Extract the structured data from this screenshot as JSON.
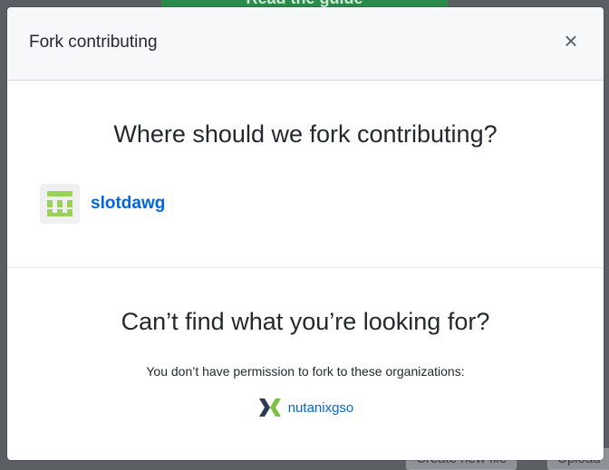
{
  "background": {
    "banner_label": "Read the guide",
    "buttons": [
      "Create new file",
      "Upload"
    ]
  },
  "modal": {
    "title": "Fork contributing",
    "close_icon": "close-icon",
    "heading": "Where should we fork contributing?",
    "owners": [
      {
        "name": "slotdawg",
        "avatar": "identicon-green"
      }
    ],
    "cannot_find": {
      "heading": "Can’t find what you’re looking for?",
      "permission_text": "You don’t have permission to fork to these organizations:",
      "organizations": [
        {
          "name": "nutanixgso",
          "logo": "nutanix-logo"
        }
      ]
    }
  },
  "colors": {
    "link": "#0366d6",
    "identicon": "#9bd05a",
    "nutanix_dark": "#2b3a57",
    "nutanix_green": "#7dc242"
  }
}
